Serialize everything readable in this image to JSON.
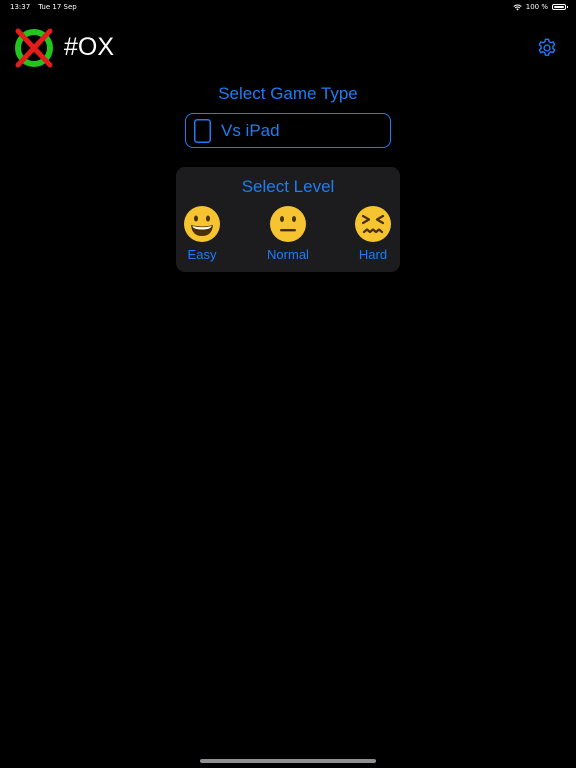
{
  "status_bar": {
    "time": "13:37",
    "date": "Tue 17 Sep",
    "battery_text": "100 %",
    "battery_level": 1.0,
    "wifi_icon": "wifi-icon"
  },
  "header": {
    "title": "#OX",
    "logo_icon": "ox-logo-icon",
    "settings_icon": "gear-icon"
  },
  "game_type": {
    "heading": "Select Game Type",
    "selected_label": "Vs iPad",
    "icon": "tablet-icon"
  },
  "level": {
    "heading": "Select Level",
    "options": [
      {
        "label": "Easy",
        "icon": "grinning-face-icon"
      },
      {
        "label": "Normal",
        "icon": "neutral-face-icon"
      },
      {
        "label": "Hard",
        "icon": "confounded-face-icon"
      }
    ]
  },
  "colors": {
    "accent": "#1f7cf5",
    "background": "#000000",
    "panel": "#1c1c1e",
    "logo_ring": "#22c51e",
    "logo_cross": "#e31c1c",
    "emoji_yellow": "#f5c430"
  }
}
